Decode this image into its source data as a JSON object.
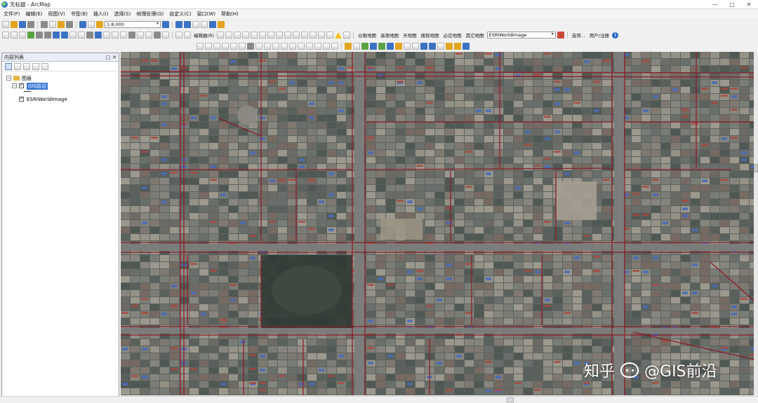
{
  "window": {
    "title": "无标题 - ArcMap",
    "controls": [
      "—",
      "□",
      "✕"
    ]
  },
  "menu": [
    "文件(F)",
    "编辑(E)",
    "视图(V)",
    "书签(B)",
    "插入(I)",
    "选择(S)",
    "地理处理(G)",
    "自定义(C)",
    "窗口(W)",
    "帮助(H)"
  ],
  "toolbar": {
    "scale": "1:8,000",
    "editor_label": "编辑器(R)",
    "tile_maps": [
      "谷歌地图",
      "高德地图",
      "天地图",
      "搜狗地图",
      "必应地图",
      "其它地图"
    ],
    "layer_select": "ESRIWorldImage",
    "select_label": "选项...",
    "user_label": "用户/注册"
  },
  "toc": {
    "title": "内容列表",
    "group_name": "图层",
    "layers": [
      {
        "name": "GIS前沿",
        "checked": true,
        "selected": true
      },
      {
        "name": "ESRIWorldImage",
        "checked": true,
        "selected": false
      }
    ]
  },
  "watermark": {
    "text_left": "知乎",
    "text_right": "@GIS前沿"
  },
  "colors": {
    "road_red": "#8a1e2a",
    "map_base": "#5d6460",
    "selection_blue": "#3b79d4"
  }
}
